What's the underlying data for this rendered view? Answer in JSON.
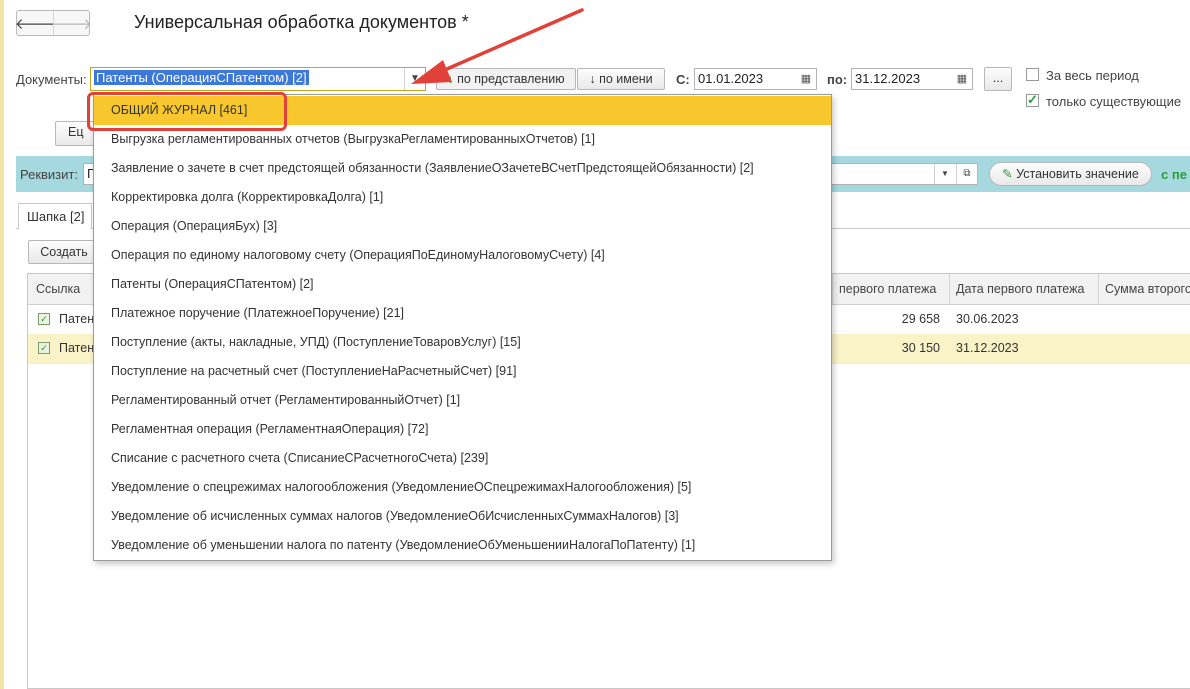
{
  "title": "Универсальная обработка документов *",
  "nav": {
    "back": "🡐",
    "forward": "🡒"
  },
  "filter": {
    "documents_label": "Документы:",
    "documents_value": "Патенты (ОперацияСПатентом) [2]",
    "sort_by_presentation": "по представлению",
    "sort_by_name": "по имени",
    "sort_arrow": "↓",
    "from_label": "С:",
    "from_date": "01.01.2023",
    "to_label": "по:",
    "to_date": "31.12.2023",
    "period_btn": "...",
    "whole_period_label": "За весь период",
    "whole_period_checked": false,
    "only_existing_label": "только существующие",
    "only_existing_checked": true
  },
  "partial_button": "Ец",
  "requisite": {
    "label": "Реквизит:",
    "value_partial": "Г",
    "set_value_button": "Установить значение",
    "right_text_partial": "с пе"
  },
  "tabs": [
    {
      "label": "Шапка [2]"
    }
  ],
  "create_button": "Создать",
  "table": {
    "headers": [
      "Ссылка",
      "первого платежа",
      "Дата первого платежа",
      "Сумма второго"
    ],
    "rows": [
      {
        "ref": "Патен",
        "amount": "29 658",
        "date": "30.06.2023",
        "highlight": false
      },
      {
        "ref": "Патен",
        "amount": "30 150",
        "date": "31.12.2023",
        "highlight": true
      }
    ]
  },
  "dropdown": {
    "items": [
      "ОБЩИЙ ЖУРНАЛ [461]",
      "Выгрузка регламентированных отчетов (ВыгрузкаРегламентированныхОтчетов) [1]",
      "Заявление о зачете в счет предстоящей обязанности (ЗаявлениеОЗачетеВСчетПредстоящейОбязанности) [2]",
      "Корректировка долга (КорректировкаДолга) [1]",
      "Операция (ОперацияБух) [3]",
      "Операция по единому налоговому счету (ОперацияПоЕдиномуНалоговомуСчету) [4]",
      "Патенты (ОперацияСПатентом) [2]",
      "Платежное поручение (ПлатежноеПоручение) [21]",
      "Поступление (акты, накладные, УПД) (ПоступлениеТоваровУслуг) [15]",
      "Поступление на расчетный счет (ПоступлениеНаРасчетныйСчет) [91]",
      "Регламентированный отчет (РегламентированныйОтчет) [1]",
      "Регламентная операция (РегламентнаяОперация) [72]",
      "Списание с расчетного счета (СписаниеСРасчетногоСчета) [239]",
      "Уведомление о спецрежимах налогообложения (УведомлениеОСпецрежимахНалогообложения) [5]",
      "Уведомление об исчисленных суммах налогов (УведомлениеОбИсчисленныхСуммахНалогов) [3]",
      "Уведомление об уменьшении налога по патенту (УведомлениеОбУменьшенииНалогаПоПатенту) [1]"
    ],
    "selected_index": 0
  },
  "colors": {
    "selection": "#f8c62d",
    "annotation": "#e2413a",
    "requisite_bar": "#a5d9df",
    "accent_green": "#2e9c3a"
  }
}
